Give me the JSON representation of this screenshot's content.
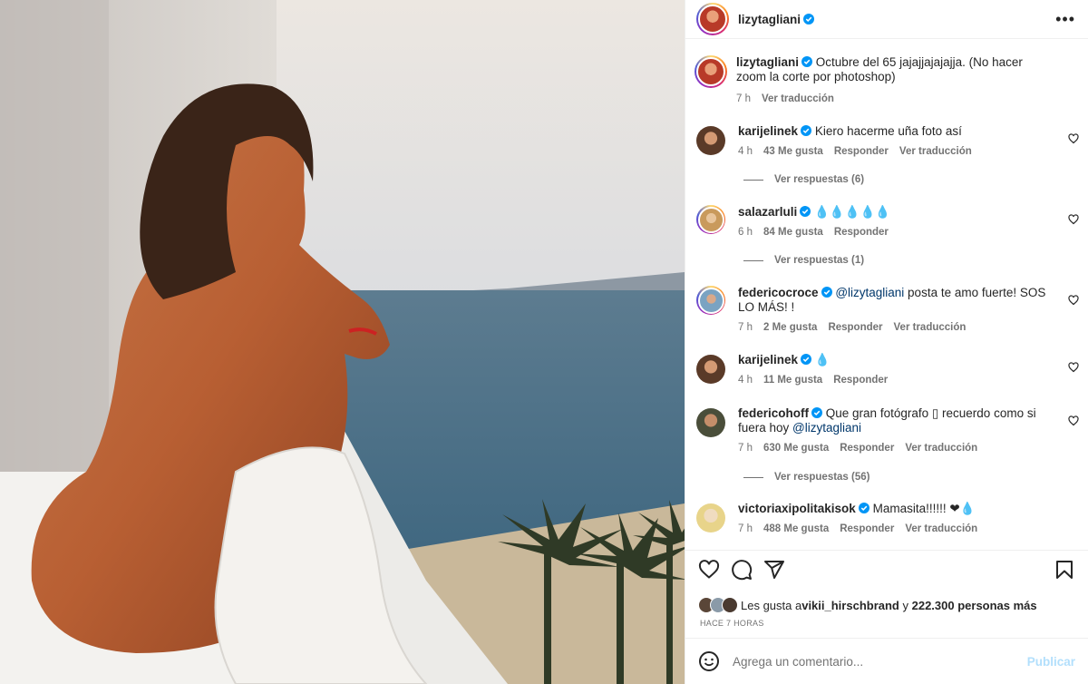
{
  "post": {
    "username": "lizytagliani",
    "caption": "Octubre del 65 jajajjajajajja. (No hacer zoom la corte por photoshop)",
    "caption_time": "7 h",
    "caption_translate": "Ver traducción"
  },
  "comments": [
    {
      "username": "karijelinek",
      "text": "Kiero hacerme uña foto así",
      "time": "4 h",
      "likes": "43 Me gusta",
      "reply": "Responder",
      "translate": "Ver traducción",
      "replies": "Ver respuestas (6)"
    },
    {
      "username": "salazarluli",
      "text": "💧💧💧💧💧",
      "time": "6 h",
      "likes": "84 Me gusta",
      "reply": "Responder",
      "replies": "Ver respuestas (1)"
    },
    {
      "username": "federicocroce",
      "mention": "@lizytagliani",
      "text": " posta te amo fuerte! SOS LO MÁS! !",
      "time": "7 h",
      "likes": "2 Me gusta",
      "reply": "Responder",
      "translate": "Ver traducción"
    },
    {
      "username": "karijelinek",
      "text": "💧",
      "time": "4 h",
      "likes": "11 Me gusta",
      "reply": "Responder"
    },
    {
      "username": "federicohoff",
      "text": "Que gran fotógrafo ▯ recuerdo como si fuera hoy ",
      "mention": "@lizytagliani",
      "time": "7 h",
      "likes": "630 Me gusta",
      "reply": "Responder",
      "translate": "Ver traducción",
      "replies": "Ver respuestas (56)"
    },
    {
      "username": "victoriaxipolitakisok",
      "text": "Mamasita!!!!!! ❤💧",
      "time": "7 h",
      "likes": "488 Me gusta",
      "reply": "Responder",
      "translate": "Ver traducción"
    }
  ],
  "likes": {
    "prefix": "Les gusta a ",
    "user": "vikii_hirschbrand",
    "middle": " y ",
    "count": "222.300 personas más"
  },
  "time_ago": "HACE 7 HORAS",
  "comment_box": {
    "placeholder": "Agrega un comentario...",
    "publish": "Publicar"
  },
  "colors": {
    "verified": "#0095f6",
    "link": "#00376b",
    "muted": "#737373",
    "publish": "#b2dffc"
  }
}
